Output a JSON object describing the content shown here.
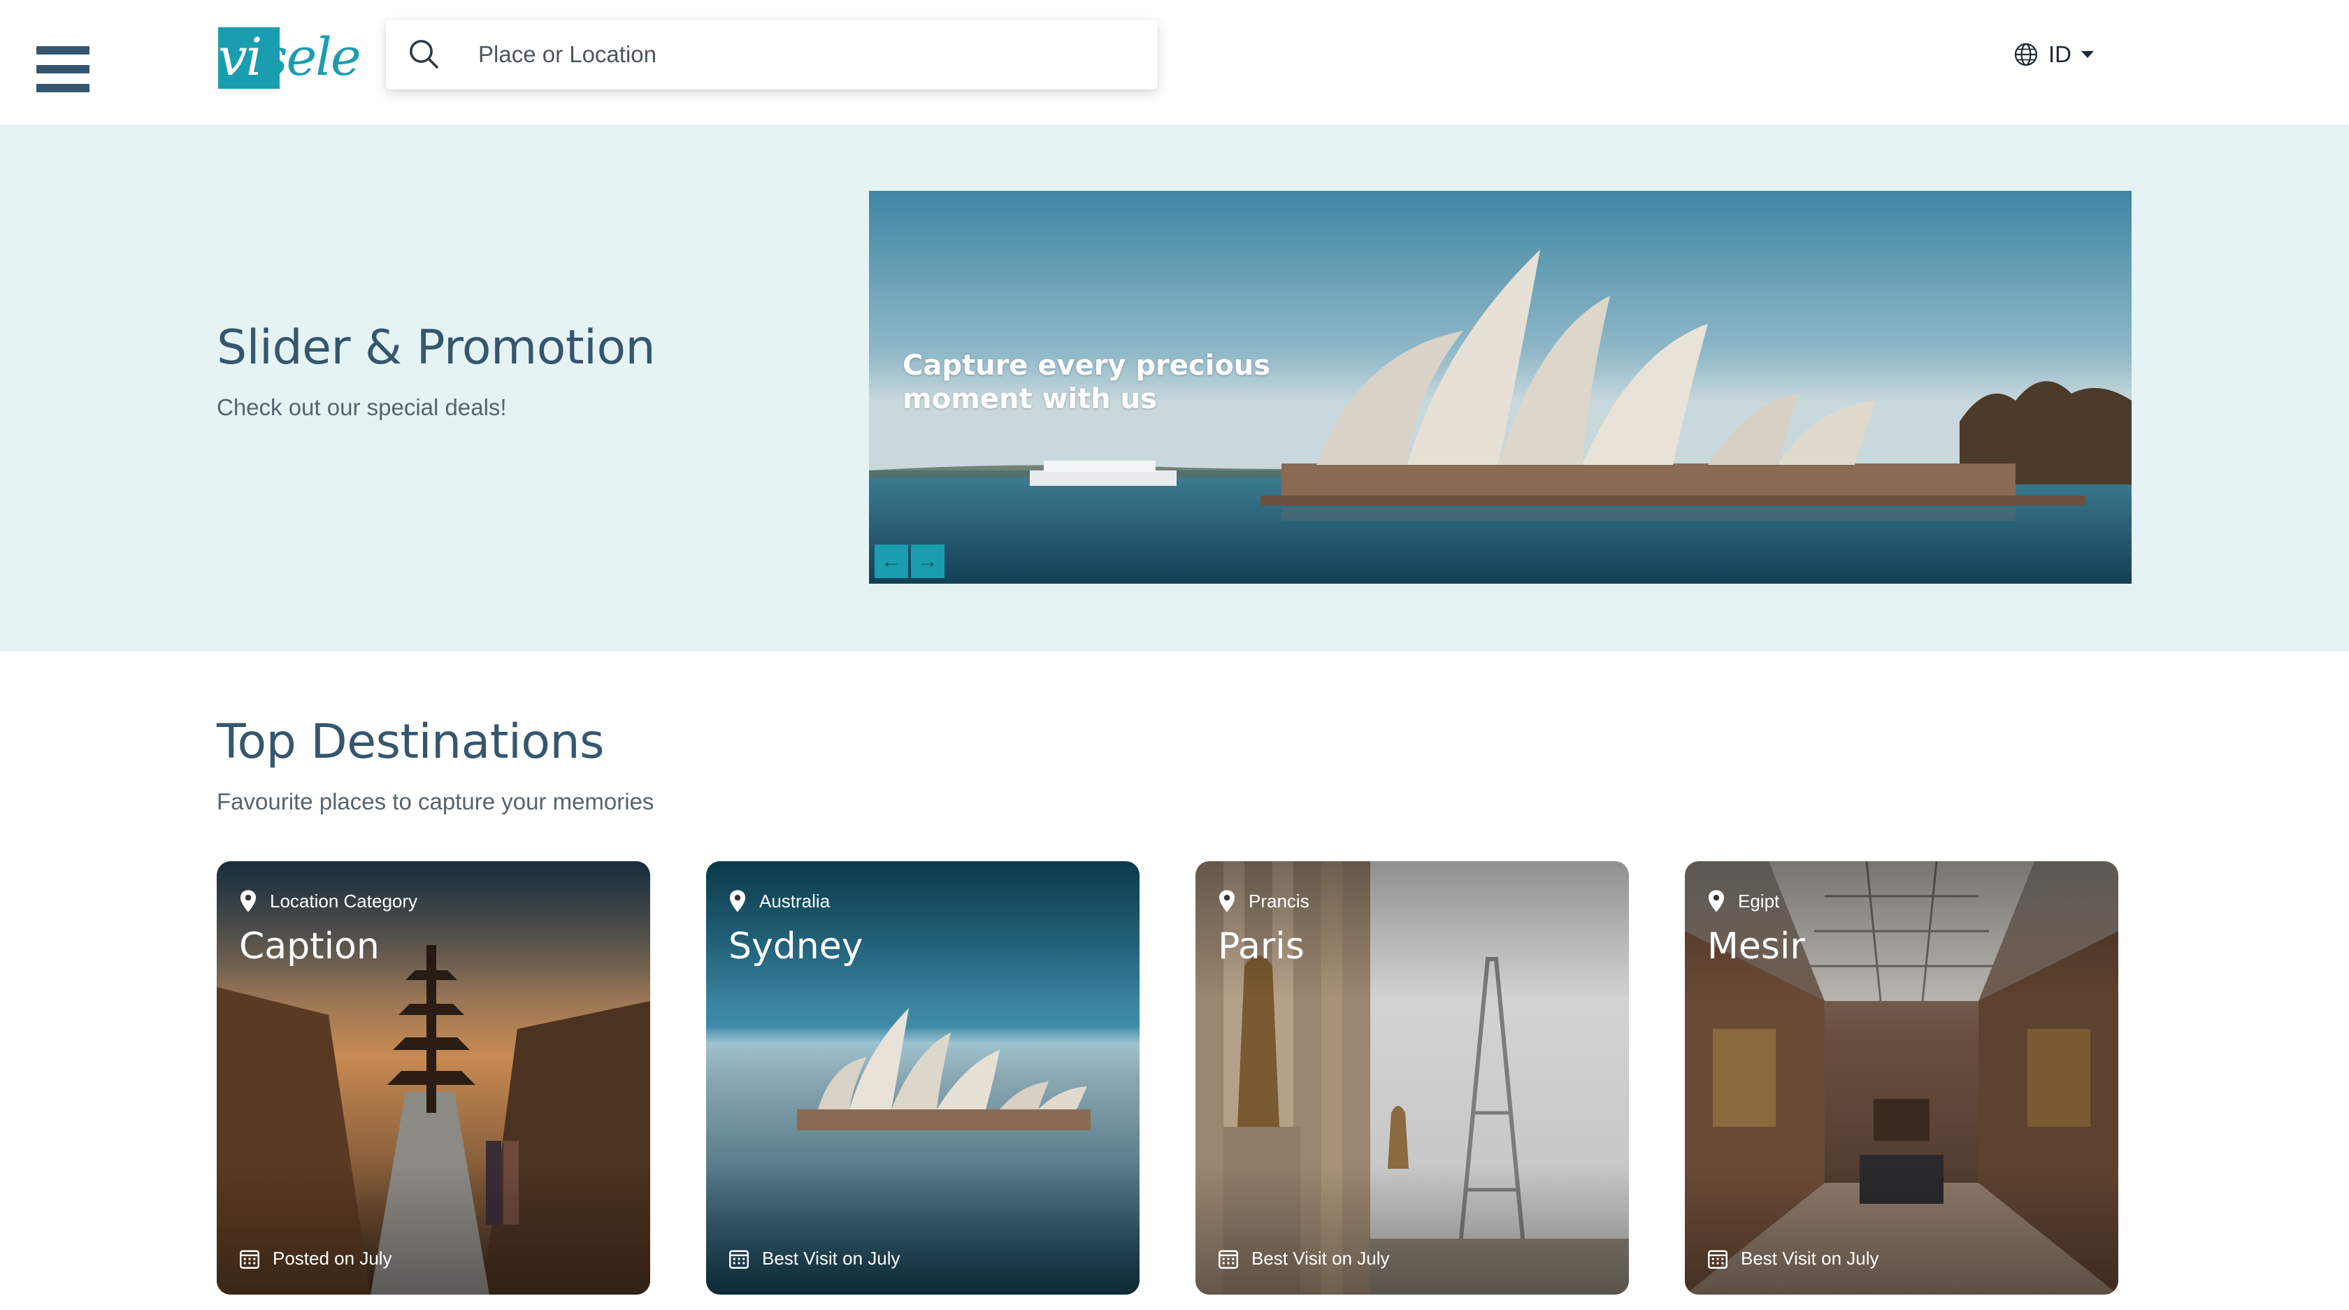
{
  "header": {
    "logo_text": "visele",
    "search": {
      "placeholder": "Place or Location",
      "value": ""
    },
    "language": "ID"
  },
  "hero": {
    "title": "Slider & Promotion",
    "subtitle": "Check out our special deals!",
    "slider": {
      "caption": "Capture every precious moment with us",
      "prev_label": "←",
      "next_label": "→"
    }
  },
  "destinations": {
    "title": "Top Destinations",
    "subtitle": "Favourite places to capture your memories",
    "cards": [
      {
        "location": "Location Category",
        "name": "Caption",
        "footer": "Posted on July",
        "image": "kyoto-pagoda-street"
      },
      {
        "location": "Australia",
        "name": "Sydney",
        "footer": "Best Visit on July",
        "image": "sydney-opera-house"
      },
      {
        "location": "Prancis",
        "name": "Paris",
        "footer": "Best Visit on July",
        "image": "eiffel-tower"
      },
      {
        "location": "Egipt",
        "name": "Mesir",
        "footer": "Best Visit on July",
        "image": "museum-gallery"
      }
    ]
  },
  "colors": {
    "accent": "#1b9db0",
    "heading": "#35566e",
    "hero_bg": "#e6f3f5"
  }
}
